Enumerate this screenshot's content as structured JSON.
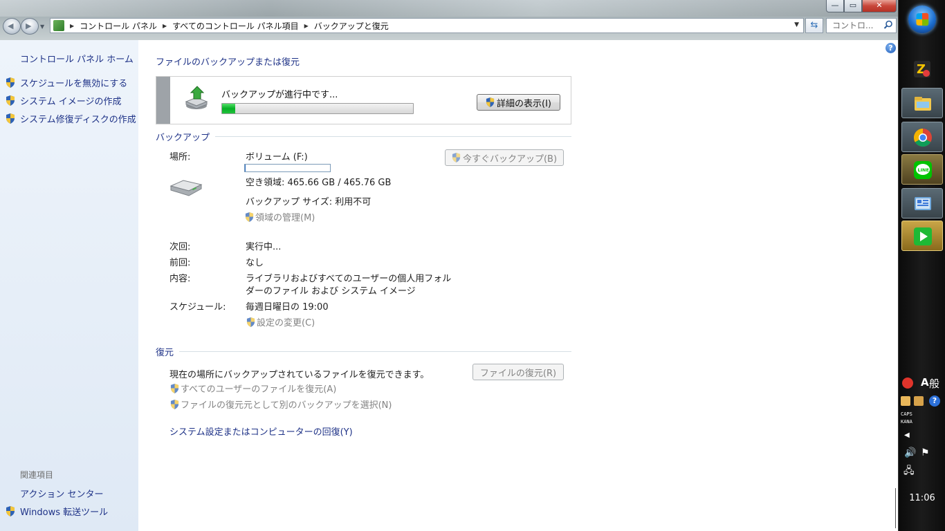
{
  "window": {
    "breadcrumb": [
      "コントロール パネル",
      "すべてのコントロール パネル項目",
      "バックアップと復元"
    ],
    "search_placeholder": "コントロ...",
    "controls": {
      "minimize": "—",
      "maximize": "▭",
      "close": "✕"
    }
  },
  "sidebar": {
    "home": "コントロール パネル ホーム",
    "tasks": [
      {
        "label": "スケジュールを無効にする",
        "icon": "uac-shield-icon"
      },
      {
        "label": "システム イメージの作成",
        "icon": "uac-shield-icon"
      },
      {
        "label": "システム修復ディスクの作成",
        "icon": "uac-shield-icon"
      }
    ],
    "related_heading": "関連項目",
    "related": [
      {
        "label": "アクション センター"
      },
      {
        "label": "Windows 転送ツール",
        "icon": "uac-shield-icon"
      }
    ]
  },
  "main": {
    "title": "ファイルのバックアップまたは復元",
    "progress": {
      "status": "バックアップが進行中です...",
      "percent": 7,
      "details_button": "詳細の表示(I)"
    },
    "backup": {
      "heading": "バックアップ",
      "location_label": "場所:",
      "location_value": "ボリューム (F:)",
      "space_used_fraction": 0.002,
      "free_space": "空き領域: 465.66 GB / 465.76 GB",
      "backup_size": "バックアップ サイズ: 利用不可",
      "manage_space": "領域の管理(M)",
      "backup_now_button": "今すぐバックアップ(B)",
      "next_label": "次回:",
      "next_value": "実行中...",
      "last_label": "前回:",
      "last_value": "なし",
      "contents_label": "内容:",
      "contents_value_line1": "ライブラリおよびすべてのユーザーの個人用フォル",
      "contents_value_line2": "ダーのファイル および システム イメージ",
      "schedule_label": "スケジュール:",
      "schedule_value": "毎週日曜日の 19:00",
      "change_settings": "設定の変更(C)"
    },
    "restore": {
      "heading": "復元",
      "description": "現在の場所にバックアップされているファイルを復元できます。",
      "restore_files_button": "ファイルの復元(R)",
      "restore_all_users": "すべてのユーザーのファイルを復元(A)",
      "select_other_backup": "ファイルの復元元として別のバックアップを選択(N)",
      "recover_system": "システム設定またはコンピューターの回復(Y)"
    }
  },
  "taskbar": {
    "apps": [
      "7zip-icon",
      "file-explorer-icon",
      "chrome-icon",
      "line-icon",
      "control-panel-icon",
      "media-player-icon"
    ],
    "ime_a": "A",
    "ime_mode": "般",
    "caps": "CAPS",
    "kana": "KANA",
    "clock": "11:06"
  },
  "colors": {
    "link": "#1e3287",
    "sidebar_bg": "#e4edf7",
    "progress_fill": "#06b025",
    "taskbar_bg": "#141414"
  }
}
